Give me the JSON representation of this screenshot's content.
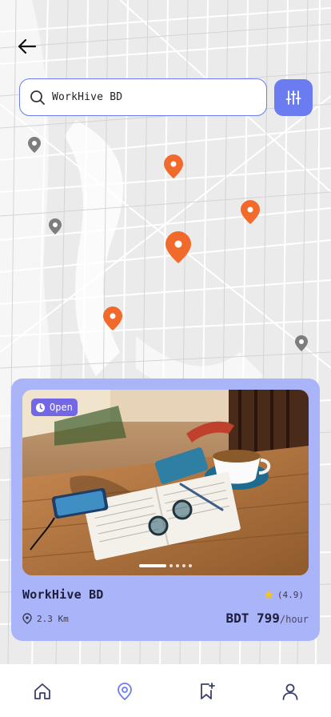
{
  "search": {
    "value": "WorkHive BD"
  },
  "card": {
    "badge": "Open",
    "name": "WorkHive BD",
    "rating": "(4.9)",
    "distance": "2.3 Km",
    "price": "BDT 799",
    "price_unit": "/hour",
    "slides_total": 5,
    "slide_active": 1
  },
  "colors": {
    "accent": "#6b7cf0",
    "pin": "#f26a2b",
    "pin_muted": "#7d7d7d",
    "card_bg": "#aab4f9",
    "badge": "#7268e6",
    "star": "#f5c518"
  },
  "icons": {
    "back": "arrow-left-icon",
    "search": "search-icon",
    "filter": "sliders-icon",
    "home": "home-icon",
    "map": "map-pin-icon",
    "saved": "bookmark-plus-icon",
    "profile": "user-icon",
    "clock": "clock-icon",
    "star": "star-icon",
    "location": "location-pin-icon"
  },
  "nav": {
    "active": "map"
  }
}
